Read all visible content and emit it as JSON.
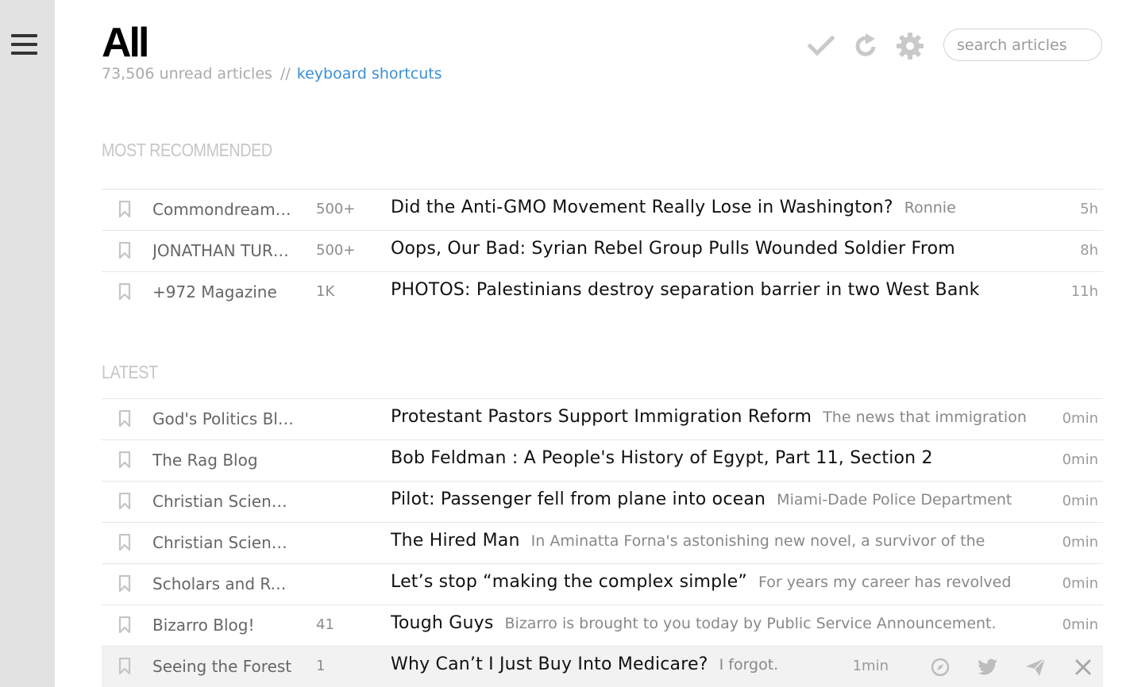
{
  "sidebar": {
    "menu_icon": "hamburger-menu-icon"
  },
  "header": {
    "title": "All",
    "unread": "73,506 unread articles",
    "separator": "//",
    "shortcuts_link": "keyboard shortcuts"
  },
  "toolbar": {
    "mark_read_icon": "checkmark-icon",
    "refresh_icon": "refresh-icon",
    "settings_icon": "gear-icon",
    "search_placeholder": "search articles"
  },
  "sections": {
    "recommended_title": "MOST RECOMMENDED",
    "latest_title": "LATEST"
  },
  "recommended": [
    {
      "source": "Commondreams.org Views",
      "count": "500+",
      "headline": "Did the Anti-GMO Movement Really Lose in Washington?",
      "snippet": "Ronnie",
      "time": "5h"
    },
    {
      "source": "JONATHAN TURLEY",
      "count": "500+",
      "headline": "Oops, Our Bad: Syrian Rebel Group Pulls Wounded Soldier From",
      "snippet": "",
      "time": "8h"
    },
    {
      "source": "+972 Magazine",
      "count": "1K",
      "headline": "PHOTOS: Palestinians destroy separation barrier in two West Bank",
      "snippet": "",
      "time": "11h"
    }
  ],
  "latest": [
    {
      "source": "God's Politics Blog",
      "count": "",
      "headline": "Protestant Pastors Support Immigration Reform",
      "snippet": "The news that immigration",
      "time": "0min"
    },
    {
      "source": "The Rag Blog",
      "count": "",
      "headline": "Bob Feldman : A People's History of Egypt, Part 11, Section 2",
      "snippet": "",
      "time": "0min"
    },
    {
      "source": "Christian Science Monitor",
      "count": "",
      "headline": "Pilot: Passenger fell from plane into ocean",
      "snippet": "Miami-Dade Police Department",
      "time": "0min"
    },
    {
      "source": "Christian Science Monitor",
      "count": "",
      "headline": "The Hired Man",
      "snippet": "In Aminatta Forna's astonishing new novel, a survivor of the",
      "time": "0min"
    },
    {
      "source": "Scholars and Rogues",
      "count": "",
      "headline": "Let’s stop “making the complex simple”",
      "snippet": "For years my career has revolved",
      "time": "0min"
    },
    {
      "source": "Bizarro Blog!",
      "count": "41",
      "headline": "Tough Guys",
      "snippet": "Bizarro is brought to you today by Public Service Announcement.",
      "time": "0min"
    },
    {
      "source": "Seeing the Forest",
      "count": "1",
      "headline": "Why Can’t I Just Buy Into Medicare?",
      "snippet": "I forgot.",
      "time": "1min"
    }
  ],
  "row_actions": [
    "compass-icon",
    "twitter-icon",
    "send-icon",
    "close-icon"
  ],
  "colors": {
    "link": "#3a8fd6",
    "sidebar": "#e2e2e2",
    "hover_row": "#f2f2f2"
  }
}
